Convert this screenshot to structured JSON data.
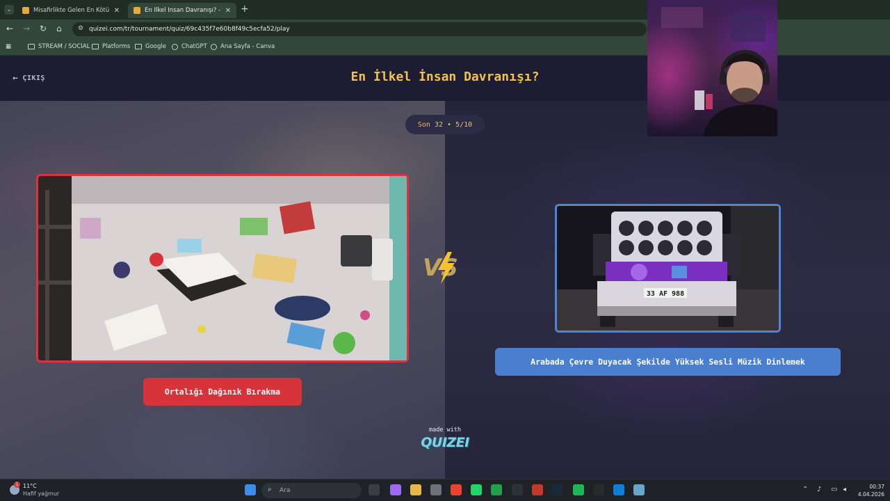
{
  "browser": {
    "tabs": [
      {
        "label": "Misafirlikte Gelen En Kötü İkram",
        "active": false
      },
      {
        "label": "En İlkel İnsan Davranışı? - Tier Li",
        "active": true
      }
    ],
    "url": "quizei.com/tr/tournament/quiz/69c435f7e60b8f49c5ecfa52/play",
    "bookmarks": [
      "STREAM / SOCIAL",
      "Platforms",
      "Google",
      "ChatGPT",
      "Ana Sayfa - Canva"
    ]
  },
  "page": {
    "exit_label": "ÇIKIŞ",
    "title": "En İlkel İnsan Davranışı?",
    "progress": "Son 32 • 5/10",
    "left_choice": "Ortalığı Dağınık Bırakma",
    "right_choice": "Arabada Çevre Duyacak Şekilde Yüksek Sesli Müzik Dinlemek",
    "vs": "VS",
    "made_with": "made with",
    "brand": "QUIZEI",
    "plate": "33 AF 988"
  },
  "colors": {
    "accent_yellow": "#f2c24a",
    "left_red": "#d6333a",
    "right_blue": "#4a7fcf",
    "brand_cyan": "#78d6e6"
  },
  "taskbar": {
    "weather_temp": "11°C",
    "weather_desc": "Hafif yağmur",
    "weather_badge": "1",
    "search_placeholder": "Ara",
    "time": "00:37",
    "date": "4.04.2026"
  }
}
